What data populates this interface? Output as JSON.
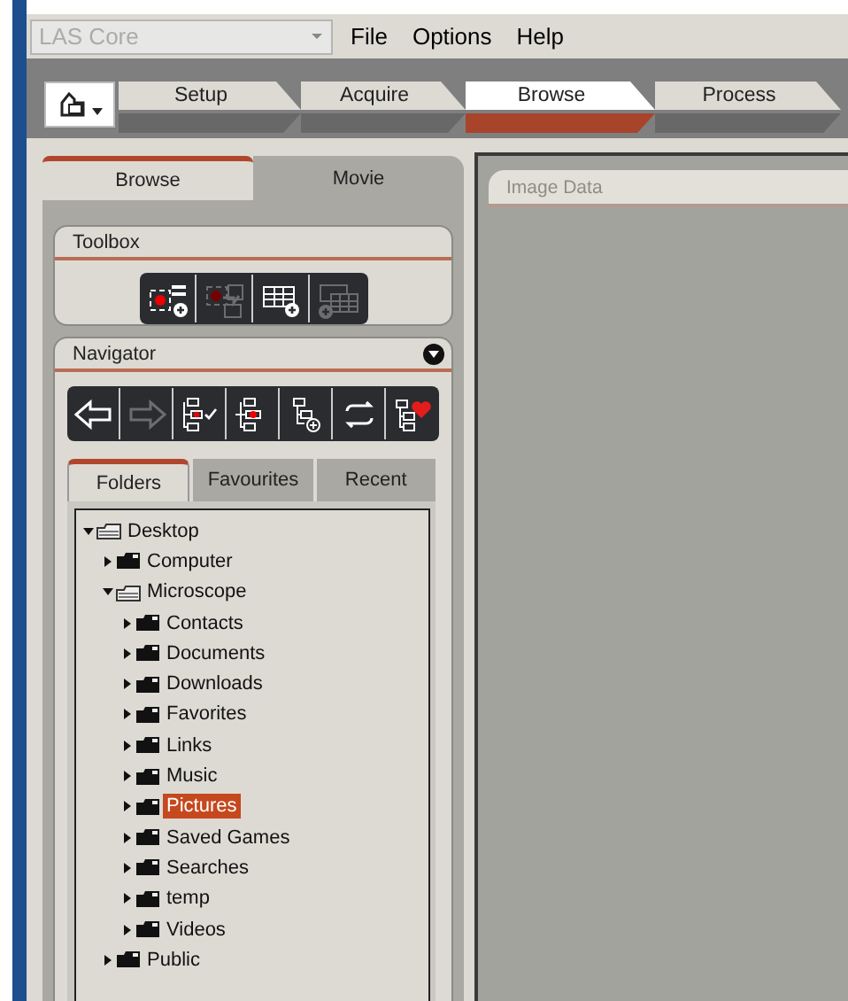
{
  "app_selector": {
    "value": "LAS Core"
  },
  "menu": [
    "File",
    "Options",
    "Help"
  ],
  "workflow_tabs": [
    {
      "label": "Setup",
      "selected": false
    },
    {
      "label": "Acquire",
      "selected": false
    },
    {
      "label": "Browse",
      "selected": true
    },
    {
      "label": "Process",
      "selected": false
    }
  ],
  "panel_tabs": [
    {
      "label": "Browse",
      "selected": true
    },
    {
      "label": "Movie",
      "selected": false
    }
  ],
  "toolbox": {
    "title": "Toolbox",
    "tools": [
      {
        "kind": "frame-add",
        "disabled": false
      },
      {
        "kind": "frame-move",
        "disabled": true
      },
      {
        "kind": "grid-add",
        "disabled": false
      },
      {
        "kind": "grid-stack",
        "disabled": true
      }
    ]
  },
  "navigator": {
    "title": "Navigator",
    "tools": [
      {
        "kind": "back",
        "disabled": false
      },
      {
        "kind": "forward",
        "disabled": true
      },
      {
        "kind": "tree-check",
        "disabled": false
      },
      {
        "kind": "tree-dot",
        "disabled": false
      },
      {
        "kind": "tree-plus",
        "disabled": false
      },
      {
        "kind": "refresh",
        "disabled": false
      },
      {
        "kind": "tree-heart",
        "disabled": false
      }
    ],
    "tabs": [
      {
        "label": "Folders",
        "selected": true
      },
      {
        "label": "Favourites",
        "selected": false
      },
      {
        "label": "Recent",
        "selected": false
      }
    ],
    "tree": [
      {
        "label": "Desktop",
        "expanded": true,
        "selected": false,
        "children": [
          {
            "label": "Computer",
            "expanded": false,
            "selected": false
          },
          {
            "label": "Microscope",
            "expanded": true,
            "selected": false,
            "children": [
              {
                "label": "Contacts",
                "expanded": false,
                "selected": false
              },
              {
                "label": "Documents",
                "expanded": false,
                "selected": false
              },
              {
                "label": "Downloads",
                "expanded": false,
                "selected": false
              },
              {
                "label": "Favorites",
                "expanded": false,
                "selected": false
              },
              {
                "label": "Links",
                "expanded": false,
                "selected": false
              },
              {
                "label": "Music",
                "expanded": false,
                "selected": false
              },
              {
                "label": "Pictures",
                "expanded": false,
                "selected": true
              },
              {
                "label": "Saved Games",
                "expanded": false,
                "selected": false
              },
              {
                "label": "Searches",
                "expanded": false,
                "selected": false
              },
              {
                "label": "temp",
                "expanded": false,
                "selected": false
              },
              {
                "label": "Videos",
                "expanded": false,
                "selected": false
              }
            ]
          },
          {
            "label": "Public",
            "expanded": false,
            "selected": false
          }
        ]
      }
    ]
  },
  "image_pane": {
    "title": "Image Data"
  }
}
